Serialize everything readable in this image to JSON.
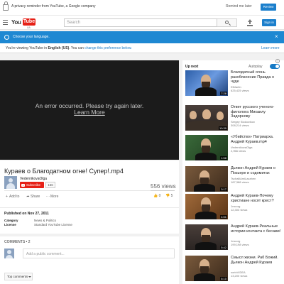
{
  "reminder": {
    "message": "A privacy reminder from YouTube, a Google company",
    "remind_later": "Remind me later",
    "review": "Review"
  },
  "masthead": {
    "logo_you": "You",
    "logo_tube": "Tube",
    "logo_locale": "UA",
    "search_placeholder": "Search",
    "sign_in": "Sign in"
  },
  "language_banner": {
    "title": "Choose your language.",
    "close": "×",
    "info_prefix": "You're viewing YouTube in ",
    "info_language": "English (US)",
    "info_middle": ". You can ",
    "info_link": "change this preference below.",
    "learn_more": "Learn more"
  },
  "player": {
    "error_line1": "An error occurred. Please try again later.",
    "error_line2": "Learn More"
  },
  "video": {
    "title": "Кураев о Благодатном огне! Супер!.mp4",
    "channel": "VedernikovaOlga",
    "subscribe_label": "Subscribe",
    "subscriber_count": "156",
    "views": "556 views",
    "likes": "0",
    "dislikes": "5",
    "actions": {
      "add_to": "Add to",
      "share": "Share",
      "more": "More"
    }
  },
  "description": {
    "published": "Published on Nov 27, 2011",
    "category_label": "Category",
    "category_value": "News & Politics",
    "license_label": "License",
    "license_value": "Standard YouTube License"
  },
  "comments": {
    "header": "COMMENTS • 2",
    "placeholder": "Add a public comment...",
    "sort_label": "Top comments"
  },
  "sidebar": {
    "up_next": "Up next",
    "autoplay": "Autoplay",
    "autoplay_on": true,
    "items": [
      {
        "title": "Благодатный огонь разоблачение Правда о чуде",
        "channel": "ElMartin",
        "views": "625,425 views",
        "duration": "7:28"
      },
      {
        "title": "Ответ русского ученого-филолога Михаилу Задорнову",
        "channel": "Sergey Skokovikov",
        "views": "308,214 views",
        "duration": "10:39"
      },
      {
        "title": "«Убийство» Патриарха. Андрей Кураев.mp4",
        "channel": "VedernikovaOlga",
        "views": "2,966 views",
        "duration": "1:58"
      },
      {
        "title": "Дьякон Андрей Кураев о Позьере и содомитах",
        "channel": "TschalliAmiLazahen",
        "views": "187,388 views",
        "duration": "3:17"
      },
      {
        "title": "Андрей Кураев-Почему христиане носят крест?",
        "channel": "1mcorg",
        "views": "12,303 views",
        "duration": "4:51"
      },
      {
        "title": "Андрей Кураев-Реальные истории контакта с бесами!",
        "channel": "1mcorg",
        "views": "199,198 views",
        "duration": "5:42"
      },
      {
        "title": "Смысл жизни. Раб Божий. Дьякон Андрей Кураев",
        "channel": "sorinVIDEA",
        "views": "13,200 views",
        "duration": "6:10"
      }
    ]
  }
}
